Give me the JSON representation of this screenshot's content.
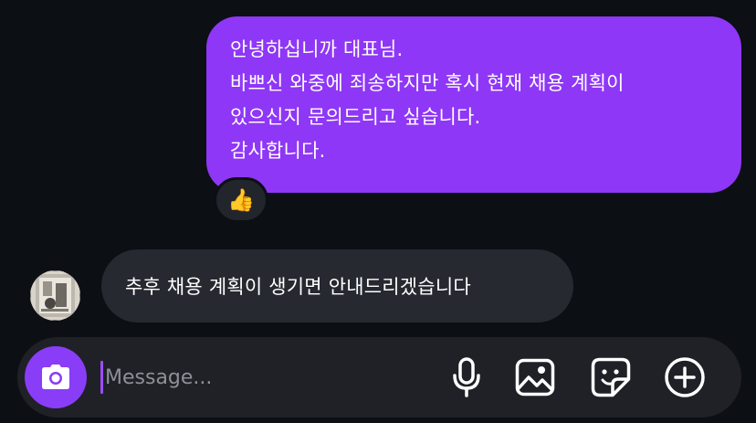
{
  "thread": {
    "outgoing": {
      "lines": [
        "안녕하십니까 대표님.",
        "바쁘신 와중에 죄송하지만 혹시 현재 채용 계획이",
        "있으신지 문의드리고 싶습니다.",
        "감사합니다."
      ],
      "reaction": "👍"
    },
    "incoming": {
      "text": "추후 채용 계획이 생기면 안내드리겠습니다"
    }
  },
  "composer": {
    "placeholder": "Message..."
  },
  "icons": {
    "camera": "camera-icon",
    "mic": "microphone-icon",
    "gallery": "image-icon",
    "sticker": "sticker-icon",
    "plus": "add-circle-icon"
  },
  "colors": {
    "outgoing_bubble": "#8f37f6",
    "incoming_bubble": "#262930",
    "camera_button": "#8a3df7",
    "background": "#0c0f14"
  }
}
